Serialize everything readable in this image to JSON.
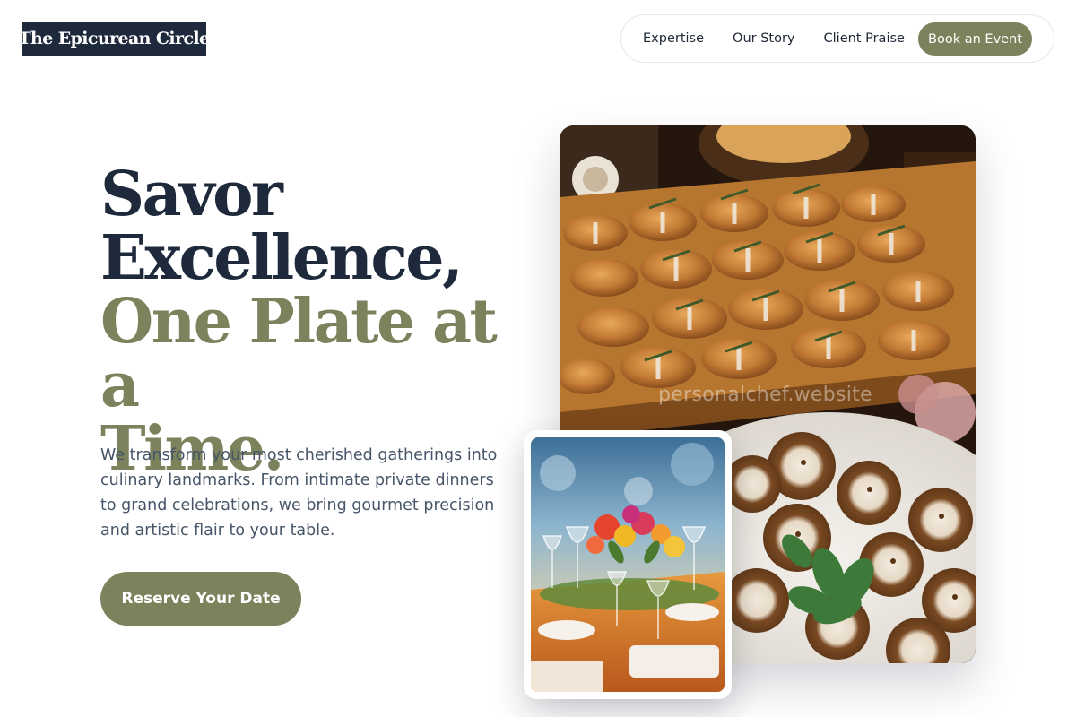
{
  "brand": {
    "name": "The Epicurean Circle"
  },
  "nav": {
    "links": [
      "Expertise",
      "Our Story",
      "Client Praise"
    ],
    "cta": "Book an Event"
  },
  "hero": {
    "headline_line1": "Savor",
    "headline_line2": "Excellence,",
    "headline_line3": "One Plate at a",
    "headline_line4": "Time.",
    "intro": "We transform your most cherished gatherings into culinary landmarks. From intimate private dinners to grand celebrations, we bring gourmet precision and artistic flair to your table.",
    "cta": "Reserve Your Date"
  },
  "images": {
    "main_watermark": "personalchef.website",
    "main_subject": "croissant-platter-photo",
    "side_subject": "table-setting-photo"
  },
  "colors": {
    "navy": "#1e293b",
    "olive": "#7b825c",
    "body_text": "#475569"
  }
}
